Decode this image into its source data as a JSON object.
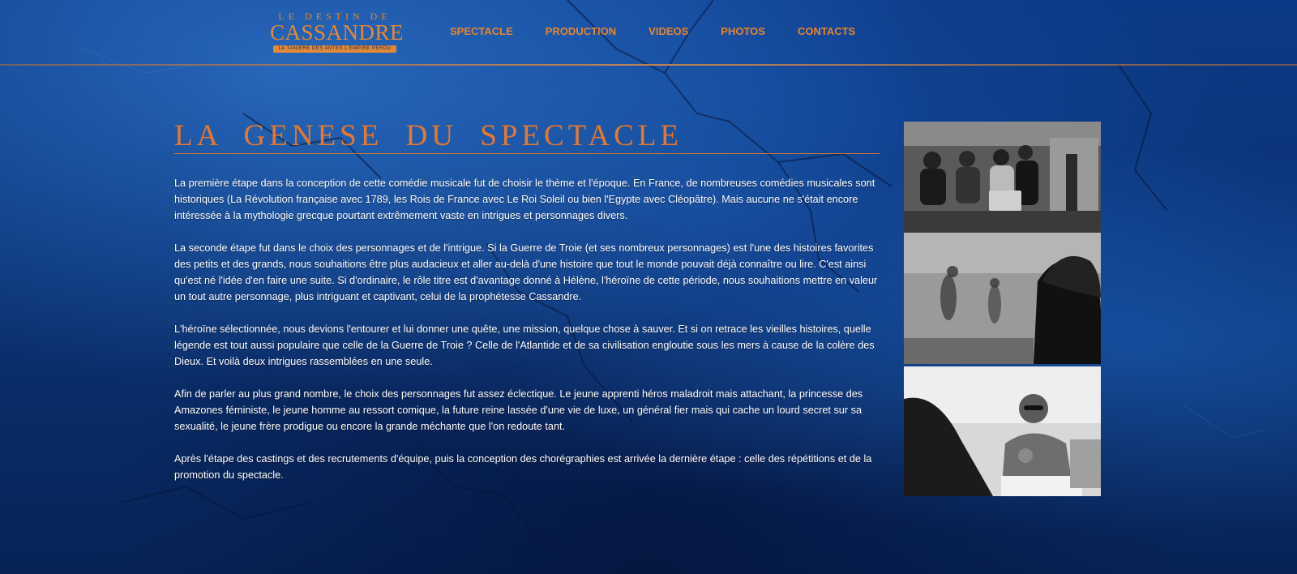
{
  "logo": {
    "top": "LE DESTIN DE",
    "main": "CASSANDRE",
    "tagline": "LA TANIÈRE DES ANTES L'EMPIRE PERDU"
  },
  "nav": {
    "items": [
      "SPECTACLE",
      "PRODUCTION",
      "VIDEOS",
      "PHOTOS",
      "CONTACTS"
    ]
  },
  "page": {
    "title": "LA GENESE DU SPECTACLE",
    "paragraphs": [
      "La première étape dans la conception de cette comédie musicale fut de choisir le thème et l'époque. En France, de nombreuses comédies musicales sont historiques (La Révolution française avec 1789, les Rois de France avec Le Roi Soleil ou bien l'Egypte avec Cléopâtre). Mais aucune ne s'était encore intéressée à la mythologie grecque pourtant extrêmement vaste en intrigues et personnages divers.",
      "La seconde étape fut dans le choix des personnages et de l'intrigue. Si la Guerre de Troie (et ses nombreux personnages) est l'une des histoires favorites des petits et des grands, nous souhaitions être plus audacieux et aller au-delà d'une histoire que tout le monde pouvait déjà connaître ou lire. C'est ainsi qu'est né l'idée d'en faire une suite. Si d'ordinaire, le rôle titre est d'avantage donné à Hélène, l'héroïne de cette période, nous souhaitions mettre en valeur un tout autre personnage, plus intriguant et captivant, celui de la prophétesse Cassandre.",
      "L'héroïne sélectionnée, nous devions l'entourer et lui donner une quête, une mission, quelque chose à sauver. Et si on retrace les vieilles histoires, quelle légende est tout aussi populaire que celle de la Guerre de Troie ? Celle de l'Atlantide et de sa civilisation engloutie sous les mers à cause de la colère des Dieux. Et voilà deux intrigues rassemblées en une seule.",
      "Afin de parler au plus grand nombre, le choix des personnages fut assez éclectique. Le jeune apprenti héros maladroit mais attachant, la princesse des Amazones féministe, le jeune homme au ressort comique, la future reine lassée d'une vie de luxe, un général fier mais qui cache un lourd secret sur sa sexualité, le jeune frère prodigue ou encore la grande méchante que l'on redoute tant.",
      "Après l'étape des castings et des recrutements d'équipe, puis la conception des chorégraphies est arrivée la dernière étape : celle des répétitions et de la promotion du spectacle."
    ]
  },
  "photos": {
    "items": [
      "group-meeting-photo",
      "dance-rehearsal-photo",
      "man-talking-photo"
    ]
  },
  "colors": {
    "accent": "#e7782a",
    "background": "#0b3278"
  }
}
